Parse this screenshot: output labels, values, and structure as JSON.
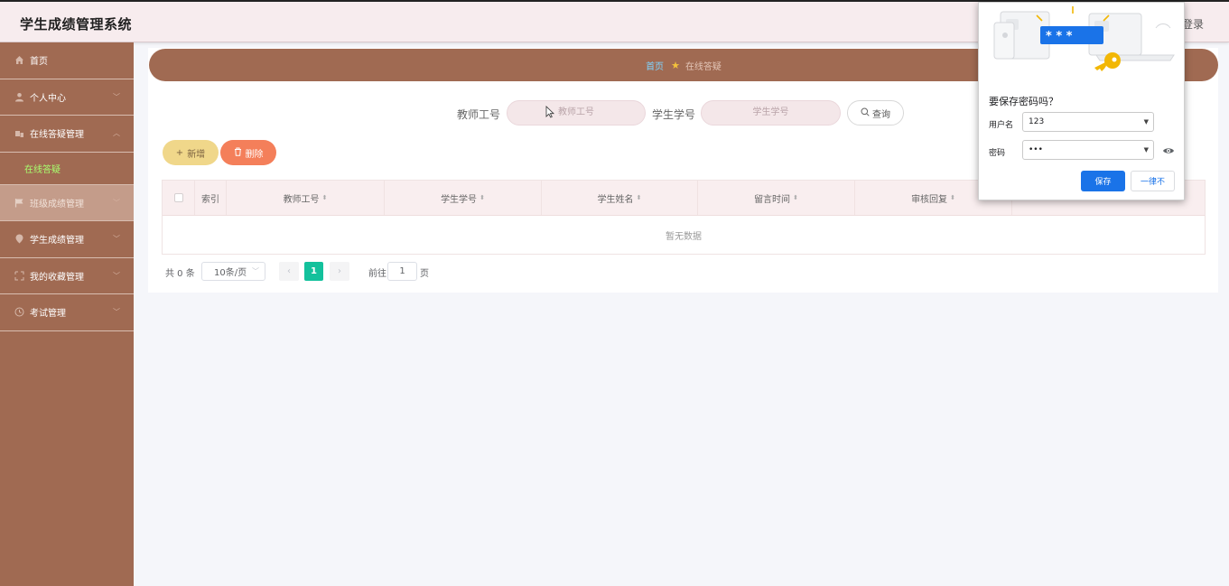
{
  "header": {
    "title": "学生成绩管理系统",
    "login": "登录"
  },
  "sidebar": {
    "items": [
      {
        "label": "首页",
        "icon": "home-icon"
      },
      {
        "label": "个人中心",
        "icon": "user-icon"
      },
      {
        "label": "在线答疑管理",
        "icon": "chat-icon"
      },
      {
        "label": "班级成绩管理",
        "icon": "flag-icon"
      },
      {
        "label": "学生成绩管理",
        "icon": "location-icon"
      },
      {
        "label": "我的收藏管理",
        "icon": "bookmark-icon"
      },
      {
        "label": "考试管理",
        "icon": "clock-icon"
      }
    ],
    "subitem": "在线答疑"
  },
  "breadcrumb": {
    "home": "首页",
    "current": "在线答疑"
  },
  "search": {
    "teacher_label": "教师工号",
    "teacher_placeholder": "教师工号",
    "student_label": "学生学号",
    "student_placeholder": "学生学号",
    "query_label": "查询"
  },
  "actions": {
    "add_label": "新增",
    "delete_label": "删除"
  },
  "table": {
    "columns": [
      "索引",
      "教师工号",
      "学生学号",
      "学生姓名",
      "留言时间",
      "审核回复"
    ],
    "empty_text": "暂无数据"
  },
  "pagination": {
    "total_text": "共 0 条",
    "page_size": "10条/页",
    "current_page": "1",
    "goto_label": "前往",
    "goto_value": "1",
    "page_label": "页"
  },
  "popup": {
    "title": "要保存密码吗？",
    "username_label": "用户名",
    "username_value": "123",
    "password_label": "密码",
    "password_value": "•••",
    "save_label": "保存",
    "never_label": "一律不",
    "illustration_text": "* * *"
  },
  "colors": {
    "sidebar": "#a06a52",
    "header": "#f7ecee",
    "accent": "#13c19c",
    "add_button": "#f0d78a",
    "delete_button": "#f47f5a",
    "popup_primary": "#1a73e8"
  }
}
